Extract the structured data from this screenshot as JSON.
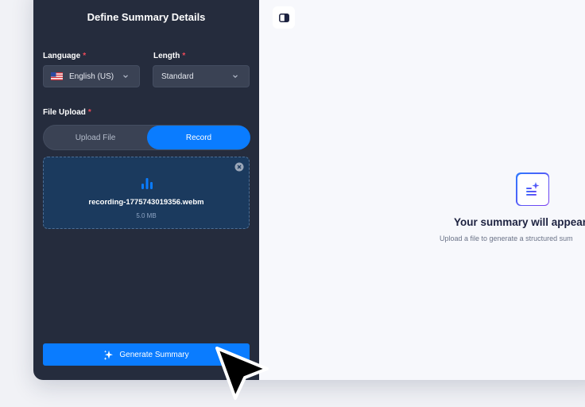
{
  "sidebar": {
    "title": "Define Summary Details",
    "language": {
      "label": "Language",
      "required": "*",
      "value": "English (US)"
    },
    "length": {
      "label": "Length",
      "required": "*",
      "value": "Standard"
    },
    "file_upload": {
      "label": "File Upload",
      "required": "*",
      "tabs": [
        "Upload File",
        "Record"
      ],
      "selected_tab": "Record"
    },
    "file": {
      "name": "recording-1775743019356.webm",
      "size": "5.0 MB"
    },
    "generate_label": "Generate Summary"
  },
  "main": {
    "empty_title": "Your summary will appear",
    "empty_subtitle": "Upload a file to generate a structured sum"
  },
  "colors": {
    "sidebar_bg": "#252c3d",
    "accent": "#0a7cff",
    "required": "#f04a5a",
    "dropzone_bg": "#1b3a5e"
  }
}
